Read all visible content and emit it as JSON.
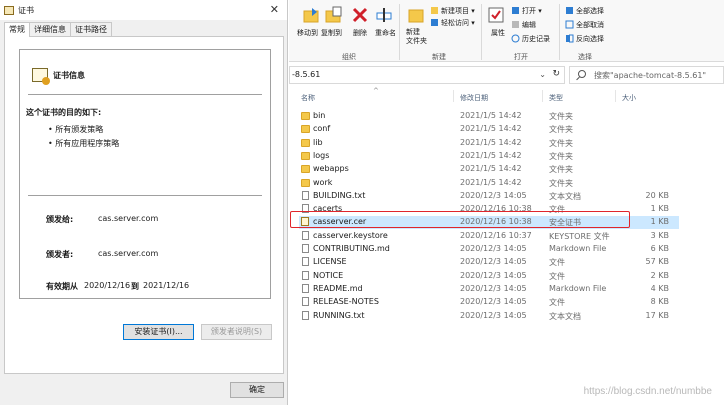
{
  "certificate_dialog": {
    "title": "证书",
    "tabs": [
      "常规",
      "详细信息",
      "证书路径"
    ],
    "info_title": "证书信息",
    "purpose_heading": "这个证书的目的如下:",
    "purposes": [
      "• 所有颁发策略",
      "• 所有应用程序策略"
    ],
    "issued_to_label": "颁发给:",
    "issued_to_value": "cas.server.com",
    "issued_by_label": "颁发者:",
    "issued_by_value": "cas.server.com",
    "valid_from_label": "有效期从",
    "valid_from": "2020/12/16",
    "valid_to_label": "到",
    "valid_to": "2021/12/16",
    "install_button": "安装证书(I)...",
    "issuer_statement_button": "颁发者说明(S)",
    "ok_button": "确定"
  },
  "ribbon": {
    "clipboard": {
      "move_to": "移动到",
      "copy_to": "复制到",
      "delete": "删除",
      "rename": "重命名",
      "label": "组织"
    },
    "new": {
      "new_folder": "新建\n文件夹",
      "new_item": "新建项目 ▾",
      "easy_access": "轻松访问 ▾",
      "label": "新建"
    },
    "open": {
      "properties": "属性",
      "open": "打开 ▾",
      "edit": "编辑",
      "history": "历史记录",
      "label": "打开"
    },
    "select": {
      "select_all": "全部选择",
      "select_none": "全部取消",
      "invert": "反向选择",
      "label": "选择"
    }
  },
  "address_bar": {
    "path": "-8.5.61"
  },
  "search": {
    "placeholder": "搜索\"apache-tomcat-8.5.61\""
  },
  "columns": {
    "name": "名称",
    "date": "修改日期",
    "type": "类型",
    "size": "大小"
  },
  "files": [
    {
      "name": "bin",
      "date": "2021/1/5 14:42",
      "type": "文件夹",
      "size": "",
      "kind": "folder"
    },
    {
      "name": "conf",
      "date": "2021/1/5 14:42",
      "type": "文件夹",
      "size": "",
      "kind": "folder"
    },
    {
      "name": "lib",
      "date": "2021/1/5 14:42",
      "type": "文件夹",
      "size": "",
      "kind": "folder"
    },
    {
      "name": "logs",
      "date": "2021/1/5 14:42",
      "type": "文件夹",
      "size": "",
      "kind": "folder"
    },
    {
      "name": "webapps",
      "date": "2021/1/5 14:42",
      "type": "文件夹",
      "size": "",
      "kind": "folder"
    },
    {
      "name": "work",
      "date": "2021/1/5 14:42",
      "type": "文件夹",
      "size": "",
      "kind": "folder"
    },
    {
      "name": "BUILDING.txt",
      "date": "2020/12/3 14:05",
      "type": "文本文档",
      "size": "20 KB",
      "kind": "file"
    },
    {
      "name": "cacerts",
      "date": "2020/12/16 10:38",
      "type": "文件",
      "size": "1 KB",
      "kind": "file"
    },
    {
      "name": "casserver.cer",
      "date": "2020/12/16 10:38",
      "type": "安全证书",
      "size": "1 KB",
      "kind": "cert"
    },
    {
      "name": "casserver.keystore",
      "date": "2020/12/16 10:37",
      "type": "KEYSTORE 文件",
      "size": "3 KB",
      "kind": "file"
    },
    {
      "name": "CONTRIBUTING.md",
      "date": "2020/12/3 14:05",
      "type": "Markdown File",
      "size": "6 KB",
      "kind": "file"
    },
    {
      "name": "LICENSE",
      "date": "2020/12/3 14:05",
      "type": "文件",
      "size": "57 KB",
      "kind": "file"
    },
    {
      "name": "NOTICE",
      "date": "2020/12/3 14:05",
      "type": "文件",
      "size": "2 KB",
      "kind": "file"
    },
    {
      "name": "README.md",
      "date": "2020/12/3 14:05",
      "type": "Markdown File",
      "size": "4 KB",
      "kind": "file"
    },
    {
      "name": "RELEASE-NOTES",
      "date": "2020/12/3 14:05",
      "type": "文件",
      "size": "8 KB",
      "kind": "file"
    },
    {
      "name": "RUNNING.txt",
      "date": "2020/12/3 14:05",
      "type": "文本文档",
      "size": "17 KB",
      "kind": "file"
    }
  ],
  "watermark": "https://blog.csdn.net/numbbe",
  "colors": {
    "folder": "#f4c84a",
    "selection": "#cce8ff",
    "highlight_border": "#e0262b",
    "accent": "#0078d7"
  }
}
